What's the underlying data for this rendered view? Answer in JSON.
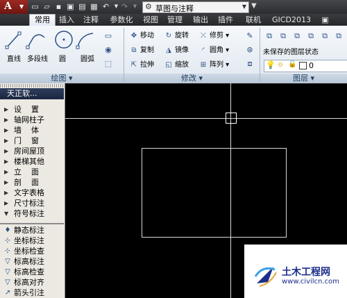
{
  "titlebar": {
    "app_logo": "A",
    "workspace": "草图与注释"
  },
  "tabs": [
    {
      "label": "常用"
    },
    {
      "label": "插入"
    },
    {
      "label": "注释"
    },
    {
      "label": "参数化"
    },
    {
      "label": "视图"
    },
    {
      "label": "管理"
    },
    {
      "label": "输出"
    },
    {
      "label": "插件"
    },
    {
      "label": "联机"
    },
    {
      "label": "GICD2013"
    }
  ],
  "draw_panel": {
    "title": "绘图",
    "line": "直线",
    "polyline": "多段线",
    "circle": "圆",
    "arc": "圆弧"
  },
  "modify_panel": {
    "title": "修改",
    "move": "移动",
    "rotate": "旋转",
    "trim": "修剪",
    "copy": "复制",
    "mirror": "镜像",
    "fillet": "圆角",
    "stretch": "拉伸",
    "scale": "缩放",
    "array": "阵列"
  },
  "layers_panel": {
    "title": "图层",
    "state": "未保存的图层状态",
    "current_layer": "0"
  },
  "palette": {
    "title": "天正软...",
    "categories": [
      "设    置",
      "轴网柱子",
      "墙    体",
      "门    窗",
      "房间屋顶",
      "楼梯其他",
      "立    面",
      "剖    面",
      "文字表格",
      "尺寸标注",
      "符号标注"
    ],
    "subitems": [
      "静态标注",
      "坐标标注",
      "坐标检查",
      "标高标注",
      "标高检查",
      "标高对齐",
      "箭头引注"
    ]
  },
  "watermark": {
    "title": "土木工程网",
    "url": "www.civilcn.com"
  }
}
